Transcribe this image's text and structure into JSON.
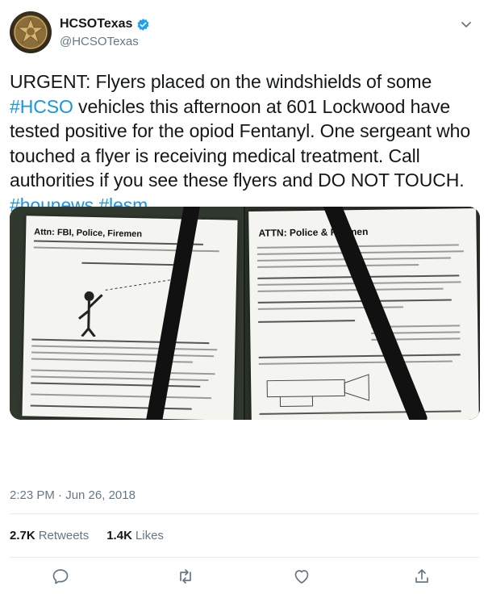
{
  "author": {
    "display_name": "HCSOTexas",
    "handle": "@HCSOTexas",
    "verified": true,
    "avatar_icon": "sheriff-star-badge-icon"
  },
  "tweet": {
    "segments": [
      {
        "text": "URGENT: Flyers placed on the windshields of some ",
        "type": "text"
      },
      {
        "text": "#HCSO",
        "type": "hashtag"
      },
      {
        "text": " vehicles this afternoon at 601 Lockwood have tested positive for the opiod Fentanyl. One sergeant who touched a flyer is receiving medical treatment. Call authorities if you see these flyers and DO NOT TOUCH. ",
        "type": "text"
      },
      {
        "text": "#hounews",
        "type": "hashtag"
      },
      {
        "text": " ",
        "type": "text"
      },
      {
        "text": "#lesm",
        "type": "hashtag"
      }
    ],
    "hashtag_color": "#1b95e0"
  },
  "media": {
    "left_photo": {
      "headline": "Attn: FBI, Police, Firemen"
    },
    "right_photo": {
      "headline": "ATTN: Police & Firemen"
    }
  },
  "meta": {
    "timestamp": "2:23 PM · Jun 26, 2018"
  },
  "stats": {
    "retweets_count": "2.7K",
    "retweets_label": "Retweets",
    "likes_count": "1.4K",
    "likes_label": "Likes"
  },
  "actions": [
    "reply-icon",
    "retweet-icon",
    "like-icon",
    "share-icon"
  ]
}
